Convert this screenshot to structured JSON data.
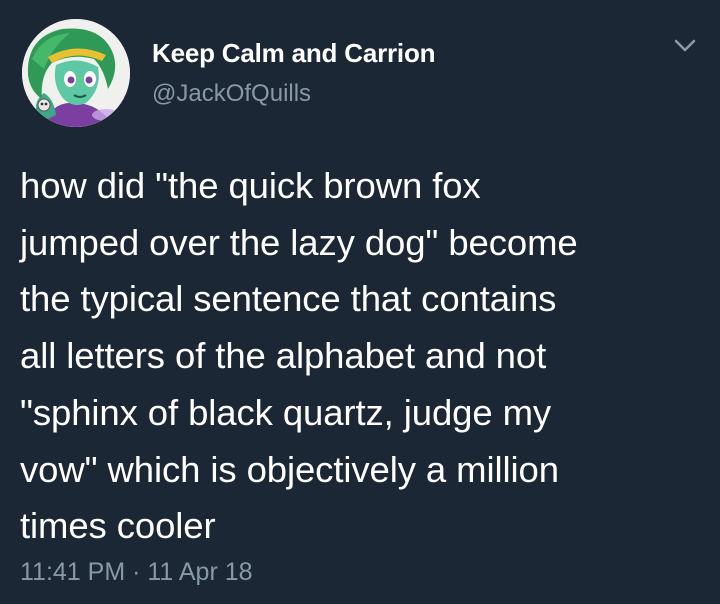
{
  "tweet": {
    "display_name": "Keep Calm and Carrion",
    "handle": "@JackOfQuills",
    "text": "how did \"the quick brown fox\njumped over the lazy dog\" become\nthe typical sentence that contains\nall letters of the alphabet and not\n\"sphinx of black quartz, judge my\nvow\" which is objectively a million\ntimes cooler",
    "timestamp": "11:41 PM · 11 Apr 18"
  },
  "icons": {
    "avatar": "cartoon-character-avatar",
    "menu": "chevron-down-icon"
  },
  "colors": {
    "background": "#1c2735",
    "primary_text": "#ffffff",
    "secondary_text": "#8899a6"
  }
}
